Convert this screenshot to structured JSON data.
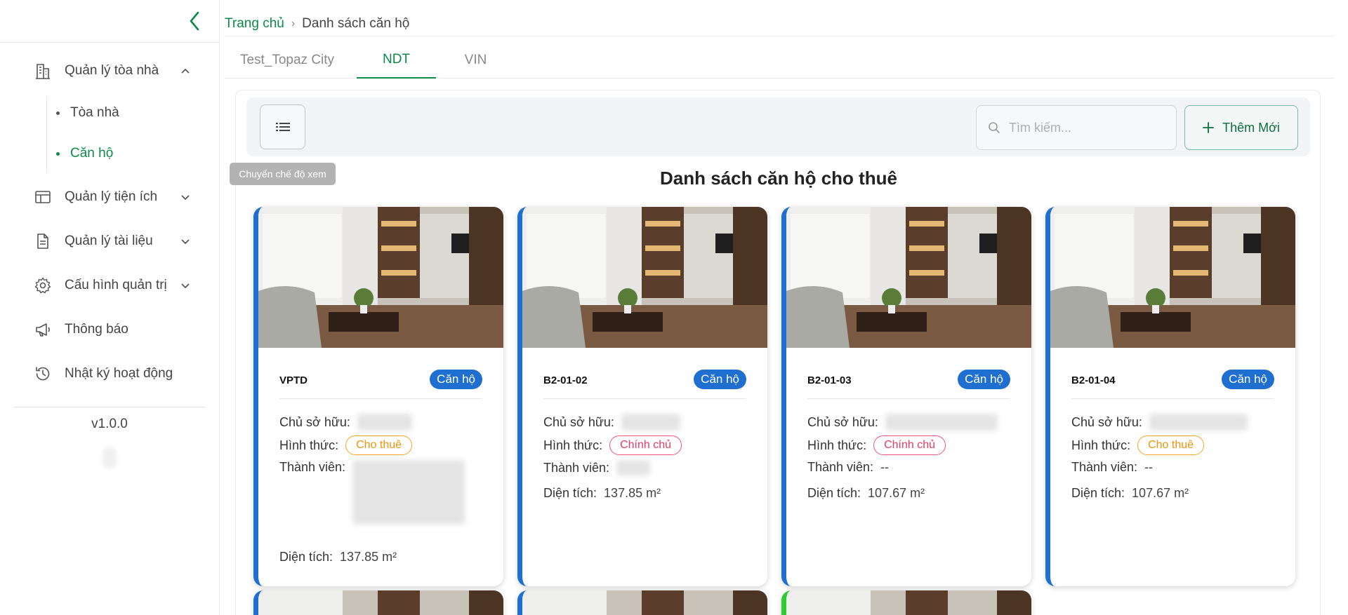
{
  "sidebar": {
    "menu": [
      {
        "label": "Quản lý tòa nhà"
      },
      {
        "label": "Quản lý tiện ích"
      },
      {
        "label": "Quản lý tài liệu"
      },
      {
        "label": "Cấu hình quản trị"
      },
      {
        "label": "Thông báo"
      },
      {
        "label": "Nhật ký hoạt động"
      }
    ],
    "sub_items": [
      {
        "label": "Tòa nhà"
      },
      {
        "label": "Căn hộ"
      }
    ],
    "version": "v1.0.0"
  },
  "breadcrumb": {
    "home": "Trang chủ",
    "separator": "›",
    "current": "Danh sách căn hộ"
  },
  "tabs": [
    {
      "label": "Test_Topaz City"
    },
    {
      "label": "NDT"
    },
    {
      "label": "VIN"
    }
  ],
  "toolbar": {
    "view_toggle_tooltip": "Chuyển chế độ xem",
    "search_placeholder": "Tìm kiếm...",
    "add_label": "Thêm Mới"
  },
  "list_title": "Danh sách căn hộ cho thuê",
  "labels": {
    "owner": "Chủ sở hữu:",
    "form": "Hình thức:",
    "members": "Thành viên:",
    "area": "Diện tích:"
  },
  "cards": [
    {
      "code": "VPTD",
      "badge": "Căn hộ",
      "form": "Cho thuê",
      "members": "",
      "area": "137.85 m²"
    },
    {
      "code": "B2-01-02",
      "badge": "Căn hộ",
      "form": "Chính chủ",
      "members": "",
      "area": "137.85 m²"
    },
    {
      "code": "B2-01-03",
      "badge": "Căn hộ",
      "form": "Chính chủ",
      "members": "--",
      "area": "107.67 m²"
    },
    {
      "code": "B2-01-04",
      "badge": "Căn hộ",
      "form": "Cho thuê",
      "members": "--",
      "area": "107.67 m²"
    }
  ],
  "colors": {
    "brand_green": "#0c8a4a",
    "badge_blue": "#1f6fd1",
    "rent_orange": "#f5a623",
    "owner_red": "#e83c62"
  }
}
